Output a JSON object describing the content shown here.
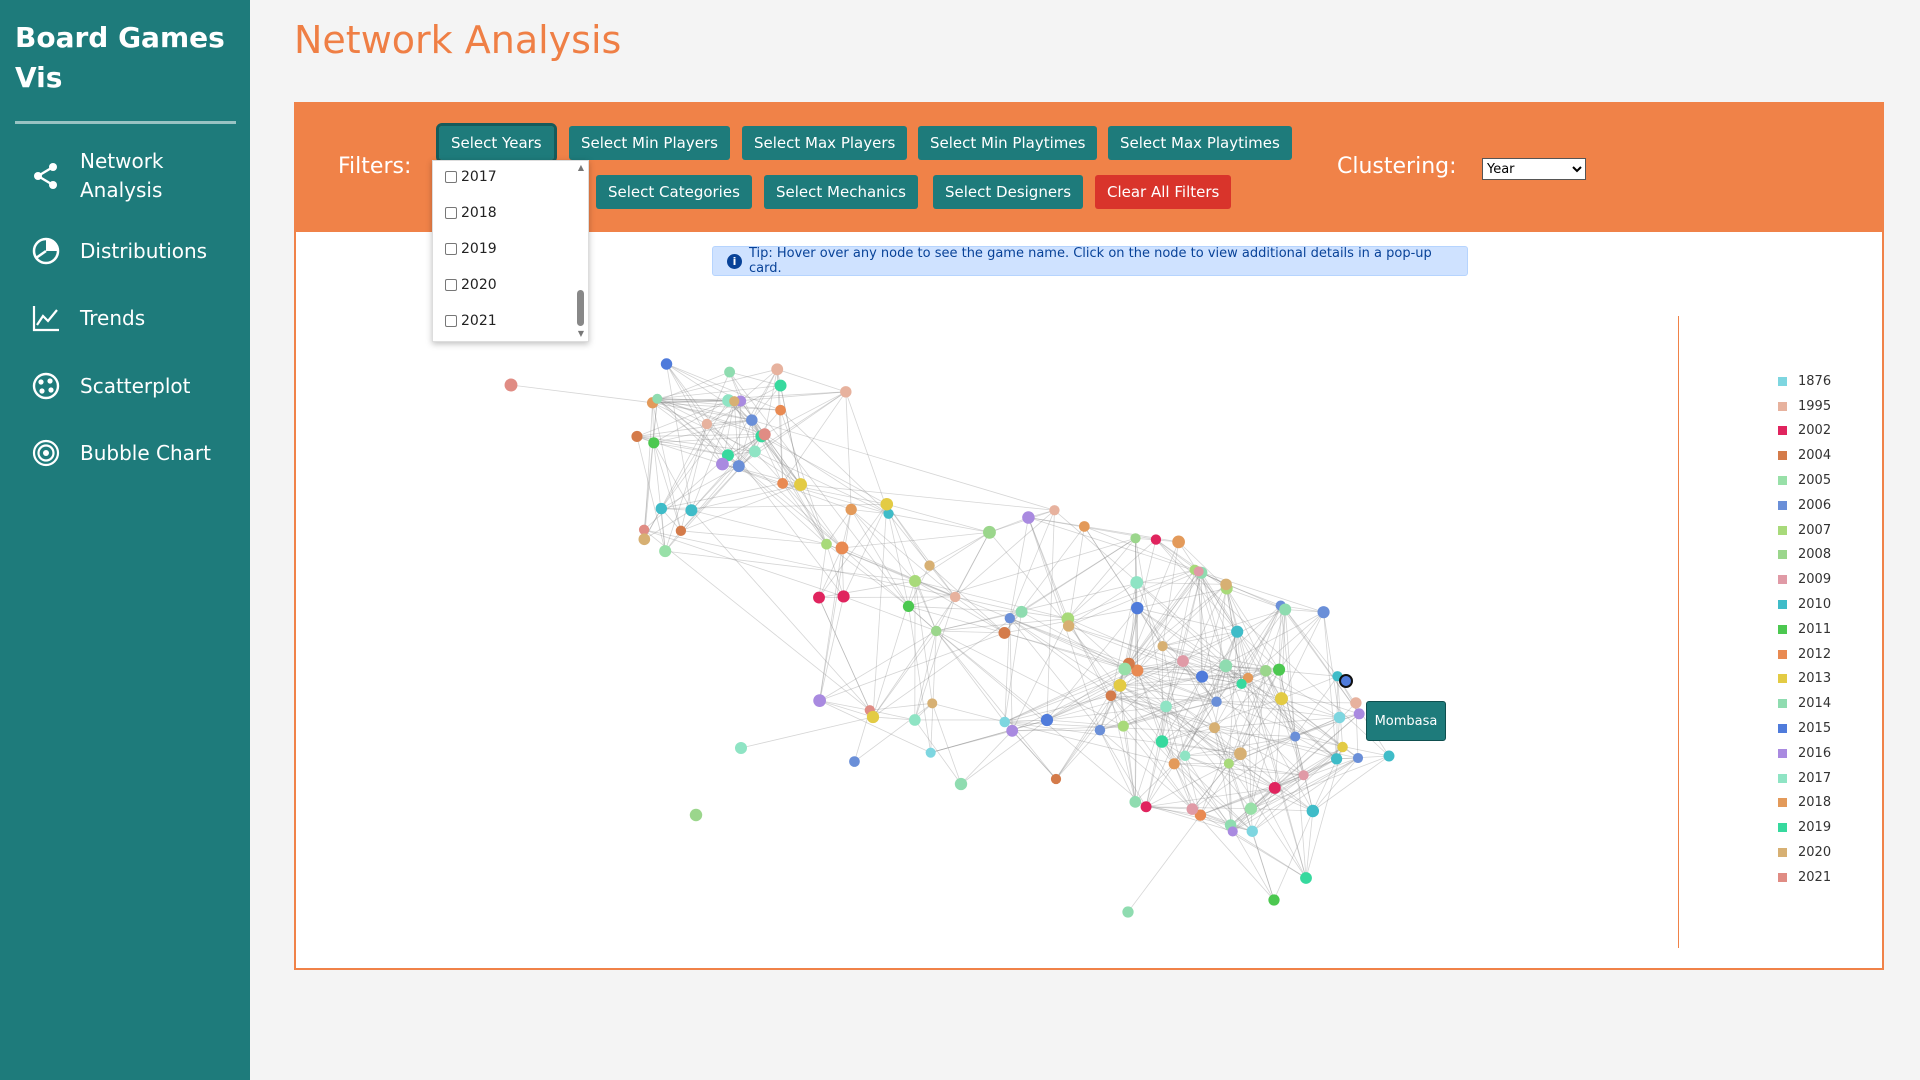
{
  "brand": {
    "line1": "Board Games",
    "line2": "Vis"
  },
  "nav": [
    {
      "label_line1": "Network",
      "label_line2": "Analysis",
      "icon": "share-icon"
    },
    {
      "label": "Distributions",
      "icon": "pie-chart-icon"
    },
    {
      "label": "Trends",
      "icon": "line-chart-icon"
    },
    {
      "label": "Scatterplot",
      "icon": "scatter-icon"
    },
    {
      "label": "Bubble Chart",
      "icon": "bubble-icon"
    }
  ],
  "page_title": "Network Analysis",
  "filters": {
    "label": "Filters:",
    "buttons": {
      "years": "Select Years",
      "min_players": "Select Min Players",
      "max_players": "Select Max Players",
      "min_playtimes": "Select Min Playtimes",
      "max_playtimes": "Select Max Playtimes",
      "categories": "Select Categories",
      "mechanics": "Select Mechanics",
      "designers": "Select Designers",
      "clear": "Clear All Filters"
    },
    "years_dropdown": [
      "2017",
      "2018",
      "2019",
      "2020",
      "2021"
    ]
  },
  "clustering": {
    "label": "Clustering:",
    "selected": "Year"
  },
  "tip": "Tip: Hover over any node to see the game name. Click on the node to view additional details in a pop-up card.",
  "tooltip": "Mombasa",
  "legend": [
    {
      "year": "1876",
      "color": "#7ed6e0"
    },
    {
      "year": "1995",
      "color": "#e7b29e"
    },
    {
      "year": "2002",
      "color": "#e0245e"
    },
    {
      "year": "2004",
      "color": "#d47b4a"
    },
    {
      "year": "2005",
      "color": "#98e0a8"
    },
    {
      "year": "2006",
      "color": "#6a8fd8"
    },
    {
      "year": "2007",
      "color": "#a8da7a"
    },
    {
      "year": "2008",
      "color": "#9bd68c"
    },
    {
      "year": "2009",
      "color": "#e09aa6"
    },
    {
      "year": "2010",
      "color": "#3fbcc8"
    },
    {
      "year": "2011",
      "color": "#4cc850"
    },
    {
      "year": "2012",
      "color": "#e98a52"
    },
    {
      "year": "2013",
      "color": "#e3cb44"
    },
    {
      "year": "2014",
      "color": "#8fdcb0"
    },
    {
      "year": "2015",
      "color": "#4f7bdb"
    },
    {
      "year": "2016",
      "color": "#a98ae0"
    },
    {
      "year": "2017",
      "color": "#8fe4c4"
    },
    {
      "year": "2018",
      "color": "#e39a5a"
    },
    {
      "year": "2019",
      "color": "#37d99e"
    },
    {
      "year": "2020",
      "color": "#d7b073"
    },
    {
      "year": "2021",
      "color": "#e08c84"
    }
  ]
}
